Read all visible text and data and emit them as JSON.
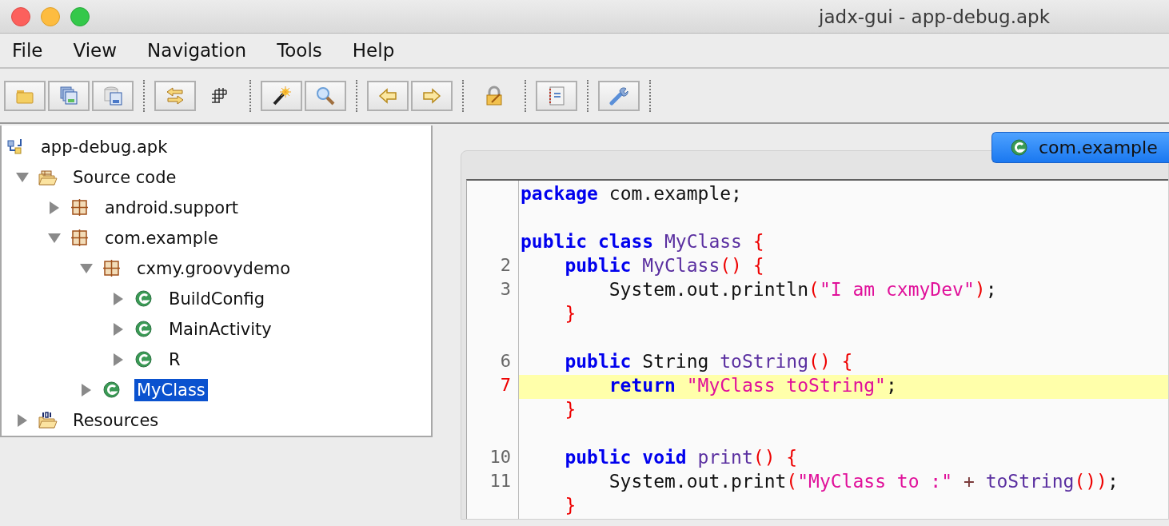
{
  "window": {
    "title": "jadx-gui - app-debug.apk"
  },
  "menu": [
    "File",
    "View",
    "Navigation",
    "Tools",
    "Help"
  ],
  "toolbar": [
    [
      {
        "kind": "folder"
      },
      {
        "kind": "saveall"
      },
      {
        "kind": "save"
      }
    ],
    [
      {
        "kind": "sync"
      },
      {
        "kind": "grid"
      }
    ],
    [
      {
        "kind": "wand"
      },
      {
        "kind": "search"
      }
    ],
    [
      {
        "kind": "back"
      },
      {
        "kind": "forward"
      }
    ],
    [
      {
        "kind": "lock"
      }
    ],
    [
      {
        "kind": "log"
      }
    ],
    [
      {
        "kind": "wrench"
      }
    ]
  ],
  "tree": [
    {
      "label": "app-debug.apk",
      "kind": "apk",
      "selected": false,
      "children": [
        {
          "label": "Source code",
          "kind": "source",
          "expanded": true,
          "selected": false,
          "children": [
            {
              "label": "android.support",
              "kind": "package",
              "expanded": false,
              "selected": false
            },
            {
              "label": "com.example",
              "kind": "package",
              "expanded": true,
              "selected": false,
              "children": [
                {
                  "label": "cxmy.groovydemo",
                  "kind": "package",
                  "expanded": true,
                  "selected": false,
                  "children": [
                    {
                      "label": "BuildConfig",
                      "kind": "class",
                      "expanded": false,
                      "selected": false
                    },
                    {
                      "label": "MainActivity",
                      "kind": "class",
                      "expanded": false,
                      "selected": false
                    },
                    {
                      "label": "R",
                      "kind": "class",
                      "expanded": false,
                      "selected": false
                    }
                  ]
                },
                {
                  "label": "MyClass",
                  "kind": "class",
                  "expanded": false,
                  "selected": true
                }
              ]
            }
          ]
        },
        {
          "label": "Resources",
          "kind": "resources",
          "expanded": false,
          "selected": false
        }
      ]
    }
  ],
  "tabs": [
    {
      "label": "com.example",
      "selected": true
    }
  ],
  "code": [
    {
      "current": false,
      "tokens": [
        {
          "kind": "keyword",
          "text": "package"
        },
        {
          "kind": "plain",
          "text": " com.example;"
        }
      ]
    },
    {
      "current": false
    },
    {
      "current": false,
      "tokens": [
        {
          "kind": "keyword",
          "text": "public class "
        },
        {
          "kind": "ident",
          "text": "MyClass "
        },
        {
          "kind": "brace",
          "text": "{"
        }
      ]
    },
    {
      "number": "2",
      "current": false,
      "tokens": [
        {
          "kind": "keyword",
          "text": "    public "
        },
        {
          "kind": "ident",
          "text": "MyClass"
        },
        {
          "kind": "brace",
          "text": "() {"
        }
      ]
    },
    {
      "number": "3",
      "current": false,
      "tokens": [
        {
          "kind": "plain",
          "text": "        System.out.println"
        },
        {
          "kind": "brace",
          "text": "("
        },
        {
          "kind": "string",
          "text": "\"I am cxmyDev\""
        },
        {
          "kind": "brace",
          "text": ")"
        },
        {
          "kind": "plain",
          "text": ";"
        }
      ]
    },
    {
      "current": false,
      "tokens": [
        {
          "kind": "brace",
          "text": "    }"
        }
      ]
    },
    {
      "current": false
    },
    {
      "number": "6",
      "current": false,
      "tokens": [
        {
          "kind": "keyword",
          "text": "    public"
        },
        {
          "kind": "plain",
          "text": " String "
        },
        {
          "kind": "ident",
          "text": "toString"
        },
        {
          "kind": "brace",
          "text": "() {"
        }
      ]
    },
    {
      "number": "7",
      "current": true,
      "tokens": [
        {
          "kind": "keyword",
          "text": "        return "
        },
        {
          "kind": "string",
          "text": "\"MyClass toString\""
        },
        {
          "kind": "plain",
          "text": ";"
        }
      ]
    },
    {
      "current": false,
      "tokens": [
        {
          "kind": "brace",
          "text": "    }"
        }
      ]
    },
    {
      "current": false
    },
    {
      "number": "10",
      "current": false,
      "tokens": [
        {
          "kind": "keyword",
          "text": "    public void "
        },
        {
          "kind": "ident",
          "text": "print"
        },
        {
          "kind": "brace",
          "text": "() {"
        }
      ]
    },
    {
      "number": "11",
      "current": false,
      "tokens": [
        {
          "kind": "plain",
          "text": "        System.out.print"
        },
        {
          "kind": "brace",
          "text": "("
        },
        {
          "kind": "string",
          "text": "\"MyClass to :\""
        },
        {
          "kind": "op",
          "text": " + "
        },
        {
          "kind": "ident",
          "text": "toString"
        },
        {
          "kind": "brace",
          "text": "())"
        },
        {
          "kind": "plain",
          "text": ";"
        }
      ]
    },
    {
      "current": false,
      "tokens": [
        {
          "kind": "brace",
          "text": "    }"
        }
      ]
    }
  ]
}
